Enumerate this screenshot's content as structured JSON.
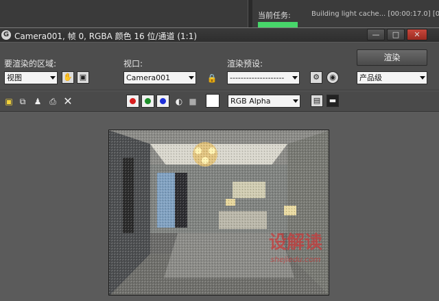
{
  "background_window": {
    "task_label": "当前任务:",
    "task_value": "Building light cache... [00:00:17.0] [00:00:"
  },
  "frame_window": {
    "title": "Camera001, 帧 0, RGBA 颜色 16 位/通道 (1:1)",
    "controls": {
      "minimize": "—",
      "maximize": "□",
      "close": "✕"
    }
  },
  "render_area": {
    "label": "要渲染的区域:",
    "value": "视图"
  },
  "viewport": {
    "label": "视口:",
    "value": "Camera001"
  },
  "preset": {
    "label": "渲染预设:",
    "value": "--------------------"
  },
  "render_button": {
    "label": "渲染"
  },
  "quality": {
    "value": "产品级"
  },
  "channel": {
    "value": "RGB Alpha"
  },
  "colors": {
    "red": "#d81e1e",
    "green": "#1e8f2a",
    "blue": "#1e2fd8",
    "accent_progress": "#47d66a"
  },
  "watermark": {
    "main": "设解读",
    "sub": "shejiedu.com"
  }
}
